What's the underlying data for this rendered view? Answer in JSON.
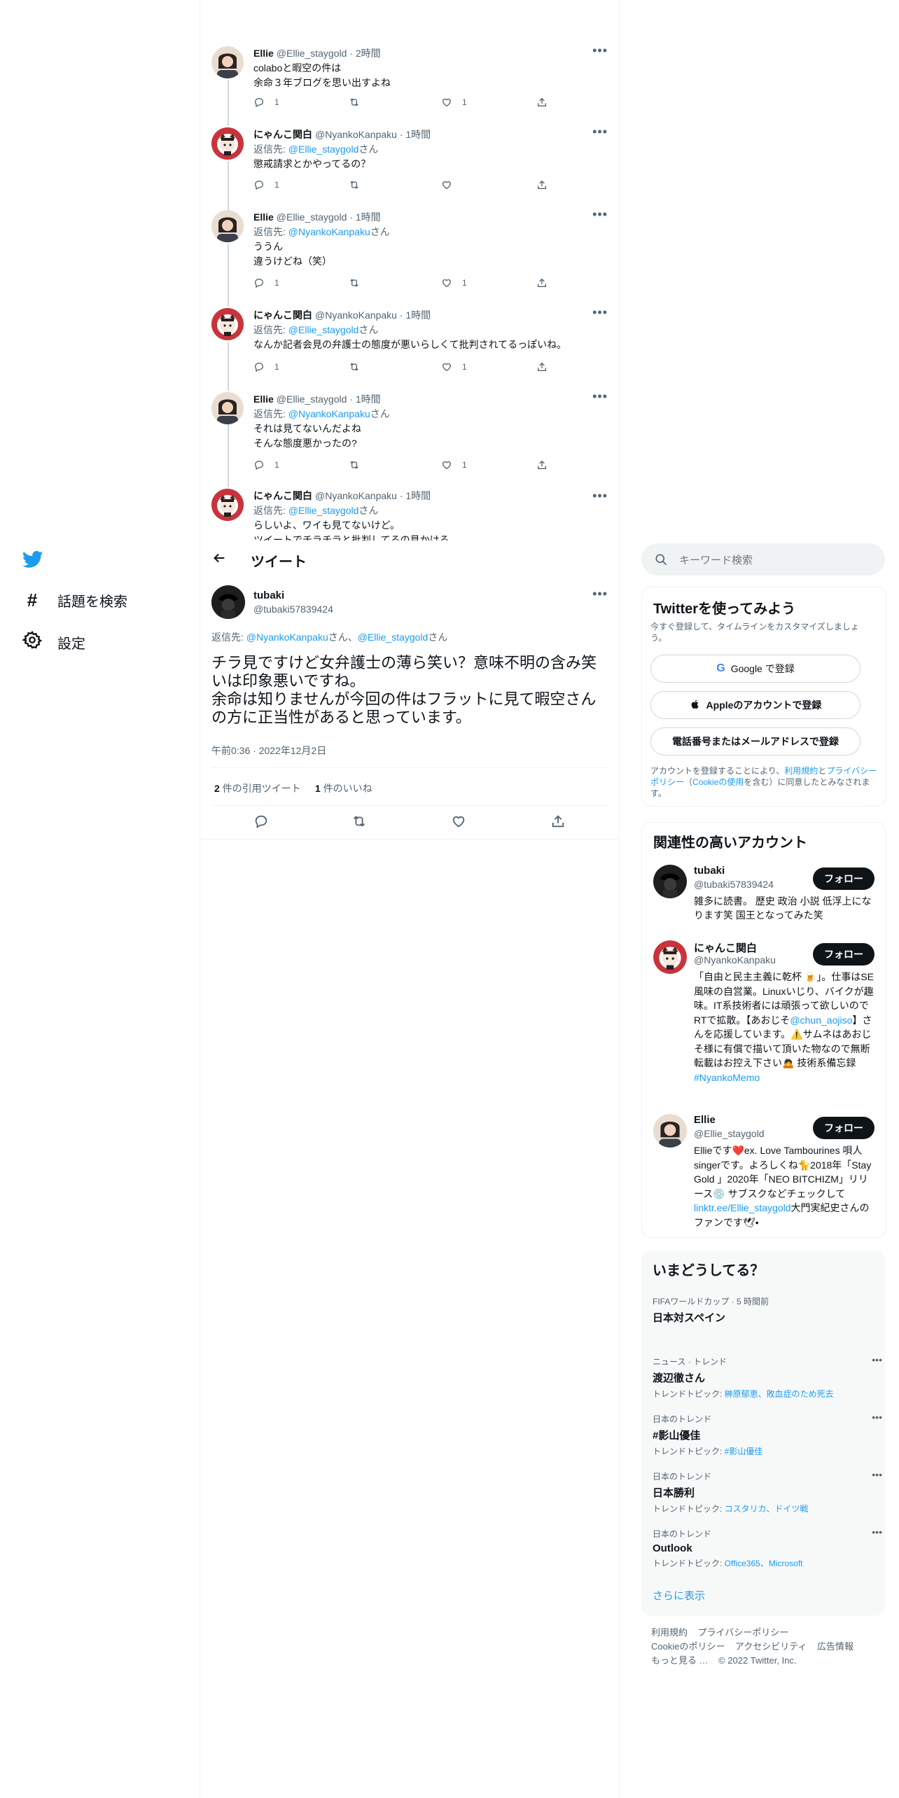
{
  "nav": {
    "explore": "話題を検索",
    "settings": "設定"
  },
  "thread": [
    {
      "name": "Ellie",
      "handle": "@Ellie_staygold",
      "time": "· 2時間",
      "reply_prefix": "",
      "reply_to": "",
      "reply_suffix": "",
      "text": "colaboと暇空の件は\n余命３年ブログを思い出すよね",
      "replies": "1",
      "retweets": "",
      "likes": "1"
    },
    {
      "name": "にゃんこ関白",
      "handle": "@NyankoKanpaku",
      "time": "· 1時間",
      "reply_prefix": "返信先: ",
      "reply_to": "@Ellie_staygold",
      "reply_suffix": "さん",
      "text": "懲戒請求とかやってるの？",
      "replies": "1",
      "retweets": "",
      "likes": ""
    },
    {
      "name": "Ellie",
      "handle": "@Ellie_staygold",
      "time": "· 1時間",
      "reply_prefix": "返信先: ",
      "reply_to": "@NyankoKanpaku",
      "reply_suffix": "さん",
      "text": "ううん\n違うけどね（笑）",
      "replies": "1",
      "retweets": "",
      "likes": "1"
    },
    {
      "name": "にゃんこ関白",
      "handle": "@NyankoKanpaku",
      "time": "· 1時間",
      "reply_prefix": "返信先: ",
      "reply_to": "@Ellie_staygold",
      "reply_suffix": "さん",
      "text": "なんか記者会見の弁護士の態度が悪いらしくて批判されてるっぽいね。",
      "replies": "1",
      "retweets": "",
      "likes": "1"
    },
    {
      "name": "Ellie",
      "handle": "@Ellie_staygold",
      "time": "· 1時間",
      "reply_prefix": "返信先: ",
      "reply_to": "@NyankoKanpaku",
      "reply_suffix": "さん",
      "text": "それは見てないんだよね\nそんな態度悪かったの?",
      "replies": "1",
      "retweets": "",
      "likes": "1"
    },
    {
      "name": "にゃんこ関白",
      "handle": "@NyankoKanpaku",
      "time": "· 1時間",
      "reply_prefix": "返信先: ",
      "reply_to": "@Ellie_staygold",
      "reply_suffix": "さん",
      "text": "らしいよ、ワイも見てないけど。\nツイートでチラチラと批判してるの見かける",
      "replies": "",
      "retweets": "",
      "likes": ""
    }
  ],
  "header": {
    "title": "ツイート"
  },
  "main_tweet": {
    "name": "tubaki",
    "handle": "@tubaki57839424",
    "reply_prefix": "返信先: ",
    "reply_to_1": "@NyankoKanpaku",
    "reply_mid": "さん、",
    "reply_to_2": "@Ellie_staygold",
    "reply_suffix": "さん",
    "text": "チラ見ですけど女弁護士の薄ら笑い？意味不明の含み笑いは印象悪いですね。\n余命は知りませんが今回の件はフラットに見て暇空さんの方に正当性があると思っています。",
    "timestamp": "午前0:36 · 2022年12月2日",
    "quote_count": "2",
    "quote_label": " 件の引用ツイート",
    "like_count": "1",
    "like_label": " 件のいいね"
  },
  "search": {
    "placeholder": "キーワード検索"
  },
  "signup": {
    "title": "Twitterを使ってみよう",
    "subtitle": "今すぐ登録して、タイムラインをカスタマイズしましょう。",
    "google": "Google で登録",
    "apple": "Appleのアカウントで登録",
    "phone": "電話番号またはメールアドレスで登録",
    "legal_1": "アカウントを登録することにより、",
    "legal_link_1": "利用規約",
    "legal_2": "と",
    "legal_link_2": "プライバシーポリシー",
    "legal_3": "（",
    "legal_link_3": "Cookieの使用",
    "legal_4": "を含む）に同意したとみなされます。"
  },
  "relevant": {
    "title": "関連性の高いアカウント",
    "follow_label": "フォロー",
    "accounts": [
      {
        "name": "tubaki",
        "handle": "@tubaki57839424",
        "bio": "雑多に読書。 歴史 政治 小説 低浮上になります笑 国王となってみた笑"
      },
      {
        "name": "にゃんこ関白",
        "handle": "@NyankoKanpaku",
        "bio": "「自由と民主主義に乾杯 🍺」。仕事はSE風味の自営業。Linuxいじり、バイクが趣味。IT系技術者には頑張って欲しいのでRTで拡散。【あおじそ",
        "bio_link": "@chun_aojiso",
        "bio_2": "】さんを応援しています。⚠️サムネはあおじそ様に有償で描いて頂いた物なので無断転載はお控え下さい🙇 技術系備忘録",
        "bio_tag": "#NyankoMemo"
      },
      {
        "name": "Ellie",
        "handle": "@Ellie_staygold",
        "bio": "Ellieです❤️ex. Love Tambourines 唄人 singerです。よろしくね🐈2018年「Stay Gold 」2020年「NEO BITCHIZM」リリース💿 サブスクなどチェックして",
        "bio_link": "linktr.ee/Ellie_staygold",
        "bio_2": "大門実紀史さんのファンです🕊•"
      }
    ]
  },
  "trends": {
    "title": "いまどうしてる？",
    "items": [
      {
        "meta": "FIFAワールドカップ · 5 時間前",
        "name": "日本対スペイン",
        "topics_label": "",
        "topics": ""
      },
      {
        "meta": "ニュース · トレンド",
        "name": "渡辺徹さん",
        "topics_label": "トレンドトピック: ",
        "topics": "榊原郁恵、敗血症のため死去"
      },
      {
        "meta": "日本のトレンド",
        "name": "#影山優佳",
        "topics_label": "トレンドトピック: ",
        "topics": "#影山優佳"
      },
      {
        "meta": "日本のトレンド",
        "name": "日本勝利",
        "topics_label": "トレンドトピック: ",
        "topics": "コスタリカ、ドイツ戦"
      },
      {
        "meta": "日本のトレンド",
        "name": "Outlook",
        "topics_label": "トレンドトピック: ",
        "topics": "Office365、Microsoft"
      }
    ],
    "show_more": "さらに表示"
  },
  "footer": {
    "terms": "利用規約",
    "privacy": "プライバシーポリシー",
    "cookie": "Cookieのポリシー",
    "access": "アクセシビリティ",
    "ads": "広告情報",
    "more": "もっと見る …",
    "copyright": "© 2022 Twitter, Inc."
  },
  "colors": {
    "accent": "#1d9bf0",
    "text": "#0f1419",
    "muted": "#536471",
    "border": "#eff3f4",
    "card": "#f7f9f9"
  }
}
